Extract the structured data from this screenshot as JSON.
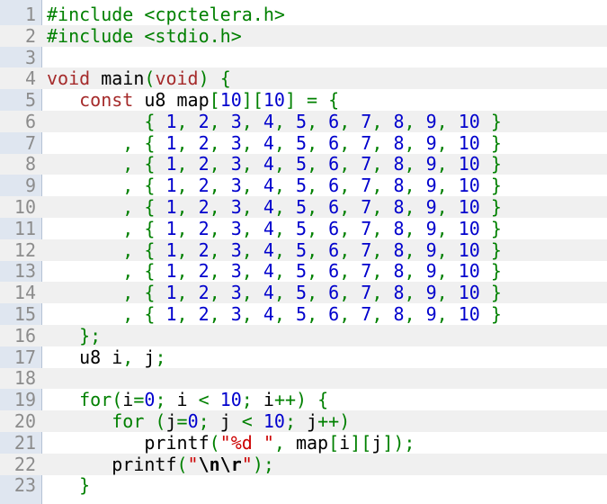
{
  "editor": {
    "lines": [
      [
        {
          "t": "#include <cpctelera.h>",
          "c": "pp"
        }
      ],
      [
        {
          "t": "#include <stdio.h>",
          "c": "pp"
        }
      ],
      [],
      [
        {
          "t": "void",
          "c": "kw"
        },
        {
          "t": " main",
          "c": "id"
        },
        {
          "t": "(",
          "c": "gr"
        },
        {
          "t": "void",
          "c": "kw"
        },
        {
          "t": ")",
          "c": "gr"
        },
        {
          "t": " {",
          "c": "gr"
        }
      ],
      [
        {
          "t": "   ",
          "c": "id"
        },
        {
          "t": "const",
          "c": "kw"
        },
        {
          "t": " u8 map",
          "c": "id"
        },
        {
          "t": "[",
          "c": "gr"
        },
        {
          "t": "10",
          "c": "num"
        },
        {
          "t": "][",
          "c": "gr"
        },
        {
          "t": "10",
          "c": "num"
        },
        {
          "t": "]",
          "c": "gr"
        },
        {
          "t": " = {",
          "c": "gr"
        }
      ],
      [
        {
          "t": "         { ",
          "c": "gr"
        },
        {
          "t": "1",
          "c": "num"
        },
        {
          "t": ", ",
          "c": "gr"
        },
        {
          "t": "2",
          "c": "num"
        },
        {
          "t": ", ",
          "c": "gr"
        },
        {
          "t": "3",
          "c": "num"
        },
        {
          "t": ", ",
          "c": "gr"
        },
        {
          "t": "4",
          "c": "num"
        },
        {
          "t": ", ",
          "c": "gr"
        },
        {
          "t": "5",
          "c": "num"
        },
        {
          "t": ", ",
          "c": "gr"
        },
        {
          "t": "6",
          "c": "num"
        },
        {
          "t": ", ",
          "c": "gr"
        },
        {
          "t": "7",
          "c": "num"
        },
        {
          "t": ", ",
          "c": "gr"
        },
        {
          "t": "8",
          "c": "num"
        },
        {
          "t": ", ",
          "c": "gr"
        },
        {
          "t": "9",
          "c": "num"
        },
        {
          "t": ", ",
          "c": "gr"
        },
        {
          "t": "10",
          "c": "num"
        },
        {
          "t": " }",
          "c": "gr"
        }
      ],
      [
        {
          "t": "       , { ",
          "c": "gr"
        },
        {
          "t": "1",
          "c": "num"
        },
        {
          "t": ", ",
          "c": "gr"
        },
        {
          "t": "2",
          "c": "num"
        },
        {
          "t": ", ",
          "c": "gr"
        },
        {
          "t": "3",
          "c": "num"
        },
        {
          "t": ", ",
          "c": "gr"
        },
        {
          "t": "4",
          "c": "num"
        },
        {
          "t": ", ",
          "c": "gr"
        },
        {
          "t": "5",
          "c": "num"
        },
        {
          "t": ", ",
          "c": "gr"
        },
        {
          "t": "6",
          "c": "num"
        },
        {
          "t": ", ",
          "c": "gr"
        },
        {
          "t": "7",
          "c": "num"
        },
        {
          "t": ", ",
          "c": "gr"
        },
        {
          "t": "8",
          "c": "num"
        },
        {
          "t": ", ",
          "c": "gr"
        },
        {
          "t": "9",
          "c": "num"
        },
        {
          "t": ", ",
          "c": "gr"
        },
        {
          "t": "10",
          "c": "num"
        },
        {
          "t": " }",
          "c": "gr"
        }
      ],
      [
        {
          "t": "       , { ",
          "c": "gr"
        },
        {
          "t": "1",
          "c": "num"
        },
        {
          "t": ", ",
          "c": "gr"
        },
        {
          "t": "2",
          "c": "num"
        },
        {
          "t": ", ",
          "c": "gr"
        },
        {
          "t": "3",
          "c": "num"
        },
        {
          "t": ", ",
          "c": "gr"
        },
        {
          "t": "4",
          "c": "num"
        },
        {
          "t": ", ",
          "c": "gr"
        },
        {
          "t": "5",
          "c": "num"
        },
        {
          "t": ", ",
          "c": "gr"
        },
        {
          "t": "6",
          "c": "num"
        },
        {
          "t": ", ",
          "c": "gr"
        },
        {
          "t": "7",
          "c": "num"
        },
        {
          "t": ", ",
          "c": "gr"
        },
        {
          "t": "8",
          "c": "num"
        },
        {
          "t": ", ",
          "c": "gr"
        },
        {
          "t": "9",
          "c": "num"
        },
        {
          "t": ", ",
          "c": "gr"
        },
        {
          "t": "10",
          "c": "num"
        },
        {
          "t": " }",
          "c": "gr"
        }
      ],
      [
        {
          "t": "       , { ",
          "c": "gr"
        },
        {
          "t": "1",
          "c": "num"
        },
        {
          "t": ", ",
          "c": "gr"
        },
        {
          "t": "2",
          "c": "num"
        },
        {
          "t": ", ",
          "c": "gr"
        },
        {
          "t": "3",
          "c": "num"
        },
        {
          "t": ", ",
          "c": "gr"
        },
        {
          "t": "4",
          "c": "num"
        },
        {
          "t": ", ",
          "c": "gr"
        },
        {
          "t": "5",
          "c": "num"
        },
        {
          "t": ", ",
          "c": "gr"
        },
        {
          "t": "6",
          "c": "num"
        },
        {
          "t": ", ",
          "c": "gr"
        },
        {
          "t": "7",
          "c": "num"
        },
        {
          "t": ", ",
          "c": "gr"
        },
        {
          "t": "8",
          "c": "num"
        },
        {
          "t": ", ",
          "c": "gr"
        },
        {
          "t": "9",
          "c": "num"
        },
        {
          "t": ", ",
          "c": "gr"
        },
        {
          "t": "10",
          "c": "num"
        },
        {
          "t": " }",
          "c": "gr"
        }
      ],
      [
        {
          "t": "       , { ",
          "c": "gr"
        },
        {
          "t": "1",
          "c": "num"
        },
        {
          "t": ", ",
          "c": "gr"
        },
        {
          "t": "2",
          "c": "num"
        },
        {
          "t": ", ",
          "c": "gr"
        },
        {
          "t": "3",
          "c": "num"
        },
        {
          "t": ", ",
          "c": "gr"
        },
        {
          "t": "4",
          "c": "num"
        },
        {
          "t": ", ",
          "c": "gr"
        },
        {
          "t": "5",
          "c": "num"
        },
        {
          "t": ", ",
          "c": "gr"
        },
        {
          "t": "6",
          "c": "num"
        },
        {
          "t": ", ",
          "c": "gr"
        },
        {
          "t": "7",
          "c": "num"
        },
        {
          "t": ", ",
          "c": "gr"
        },
        {
          "t": "8",
          "c": "num"
        },
        {
          "t": ", ",
          "c": "gr"
        },
        {
          "t": "9",
          "c": "num"
        },
        {
          "t": ", ",
          "c": "gr"
        },
        {
          "t": "10",
          "c": "num"
        },
        {
          "t": " }",
          "c": "gr"
        }
      ],
      [
        {
          "t": "       , { ",
          "c": "gr"
        },
        {
          "t": "1",
          "c": "num"
        },
        {
          "t": ", ",
          "c": "gr"
        },
        {
          "t": "2",
          "c": "num"
        },
        {
          "t": ", ",
          "c": "gr"
        },
        {
          "t": "3",
          "c": "num"
        },
        {
          "t": ", ",
          "c": "gr"
        },
        {
          "t": "4",
          "c": "num"
        },
        {
          "t": ", ",
          "c": "gr"
        },
        {
          "t": "5",
          "c": "num"
        },
        {
          "t": ", ",
          "c": "gr"
        },
        {
          "t": "6",
          "c": "num"
        },
        {
          "t": ", ",
          "c": "gr"
        },
        {
          "t": "7",
          "c": "num"
        },
        {
          "t": ", ",
          "c": "gr"
        },
        {
          "t": "8",
          "c": "num"
        },
        {
          "t": ", ",
          "c": "gr"
        },
        {
          "t": "9",
          "c": "num"
        },
        {
          "t": ", ",
          "c": "gr"
        },
        {
          "t": "10",
          "c": "num"
        },
        {
          "t": " }",
          "c": "gr"
        }
      ],
      [
        {
          "t": "       , { ",
          "c": "gr"
        },
        {
          "t": "1",
          "c": "num"
        },
        {
          "t": ", ",
          "c": "gr"
        },
        {
          "t": "2",
          "c": "num"
        },
        {
          "t": ", ",
          "c": "gr"
        },
        {
          "t": "3",
          "c": "num"
        },
        {
          "t": ", ",
          "c": "gr"
        },
        {
          "t": "4",
          "c": "num"
        },
        {
          "t": ", ",
          "c": "gr"
        },
        {
          "t": "5",
          "c": "num"
        },
        {
          "t": ", ",
          "c": "gr"
        },
        {
          "t": "6",
          "c": "num"
        },
        {
          "t": ", ",
          "c": "gr"
        },
        {
          "t": "7",
          "c": "num"
        },
        {
          "t": ", ",
          "c": "gr"
        },
        {
          "t": "8",
          "c": "num"
        },
        {
          "t": ", ",
          "c": "gr"
        },
        {
          "t": "9",
          "c": "num"
        },
        {
          "t": ", ",
          "c": "gr"
        },
        {
          "t": "10",
          "c": "num"
        },
        {
          "t": " }",
          "c": "gr"
        }
      ],
      [
        {
          "t": "       , { ",
          "c": "gr"
        },
        {
          "t": "1",
          "c": "num"
        },
        {
          "t": ", ",
          "c": "gr"
        },
        {
          "t": "2",
          "c": "num"
        },
        {
          "t": ", ",
          "c": "gr"
        },
        {
          "t": "3",
          "c": "num"
        },
        {
          "t": ", ",
          "c": "gr"
        },
        {
          "t": "4",
          "c": "num"
        },
        {
          "t": ", ",
          "c": "gr"
        },
        {
          "t": "5",
          "c": "num"
        },
        {
          "t": ", ",
          "c": "gr"
        },
        {
          "t": "6",
          "c": "num"
        },
        {
          "t": ", ",
          "c": "gr"
        },
        {
          "t": "7",
          "c": "num"
        },
        {
          "t": ", ",
          "c": "gr"
        },
        {
          "t": "8",
          "c": "num"
        },
        {
          "t": ", ",
          "c": "gr"
        },
        {
          "t": "9",
          "c": "num"
        },
        {
          "t": ", ",
          "c": "gr"
        },
        {
          "t": "10",
          "c": "num"
        },
        {
          "t": " }",
          "c": "gr"
        }
      ],
      [
        {
          "t": "       , { ",
          "c": "gr"
        },
        {
          "t": "1",
          "c": "num"
        },
        {
          "t": ", ",
          "c": "gr"
        },
        {
          "t": "2",
          "c": "num"
        },
        {
          "t": ", ",
          "c": "gr"
        },
        {
          "t": "3",
          "c": "num"
        },
        {
          "t": ", ",
          "c": "gr"
        },
        {
          "t": "4",
          "c": "num"
        },
        {
          "t": ", ",
          "c": "gr"
        },
        {
          "t": "5",
          "c": "num"
        },
        {
          "t": ", ",
          "c": "gr"
        },
        {
          "t": "6",
          "c": "num"
        },
        {
          "t": ", ",
          "c": "gr"
        },
        {
          "t": "7",
          "c": "num"
        },
        {
          "t": ", ",
          "c": "gr"
        },
        {
          "t": "8",
          "c": "num"
        },
        {
          "t": ", ",
          "c": "gr"
        },
        {
          "t": "9",
          "c": "num"
        },
        {
          "t": ", ",
          "c": "gr"
        },
        {
          "t": "10",
          "c": "num"
        },
        {
          "t": " }",
          "c": "gr"
        }
      ],
      [
        {
          "t": "       , { ",
          "c": "gr"
        },
        {
          "t": "1",
          "c": "num"
        },
        {
          "t": ", ",
          "c": "gr"
        },
        {
          "t": "2",
          "c": "num"
        },
        {
          "t": ", ",
          "c": "gr"
        },
        {
          "t": "3",
          "c": "num"
        },
        {
          "t": ", ",
          "c": "gr"
        },
        {
          "t": "4",
          "c": "num"
        },
        {
          "t": ", ",
          "c": "gr"
        },
        {
          "t": "5",
          "c": "num"
        },
        {
          "t": ", ",
          "c": "gr"
        },
        {
          "t": "6",
          "c": "num"
        },
        {
          "t": ", ",
          "c": "gr"
        },
        {
          "t": "7",
          "c": "num"
        },
        {
          "t": ", ",
          "c": "gr"
        },
        {
          "t": "8",
          "c": "num"
        },
        {
          "t": ", ",
          "c": "gr"
        },
        {
          "t": "9",
          "c": "num"
        },
        {
          "t": ", ",
          "c": "gr"
        },
        {
          "t": "10",
          "c": "num"
        },
        {
          "t": " }",
          "c": "gr"
        }
      ],
      [
        {
          "t": "   };",
          "c": "gr"
        }
      ],
      [
        {
          "t": "   u8 i",
          "c": "id"
        },
        {
          "t": ",",
          "c": "gr"
        },
        {
          "t": " j",
          "c": "id"
        },
        {
          "t": ";",
          "c": "gr"
        }
      ],
      [],
      [
        {
          "t": "   ",
          "c": "id"
        },
        {
          "t": "for",
          "c": "bl"
        },
        {
          "t": "(",
          "c": "gr"
        },
        {
          "t": "i",
          "c": "id"
        },
        {
          "t": "=",
          "c": "gr"
        },
        {
          "t": "0",
          "c": "num"
        },
        {
          "t": ";",
          "c": "gr"
        },
        {
          "t": " i ",
          "c": "id"
        },
        {
          "t": "<",
          "c": "gr"
        },
        {
          "t": " ",
          "c": "id"
        },
        {
          "t": "10",
          "c": "num"
        },
        {
          "t": ";",
          "c": "gr"
        },
        {
          "t": " i",
          "c": "id"
        },
        {
          "t": "++)",
          "c": "gr"
        },
        {
          "t": " {",
          "c": "gr"
        }
      ],
      [
        {
          "t": "      ",
          "c": "id"
        },
        {
          "t": "for",
          "c": "bl"
        },
        {
          "t": " (",
          "c": "gr"
        },
        {
          "t": "j",
          "c": "id"
        },
        {
          "t": "=",
          "c": "gr"
        },
        {
          "t": "0",
          "c": "num"
        },
        {
          "t": ";",
          "c": "gr"
        },
        {
          "t": " j ",
          "c": "id"
        },
        {
          "t": "<",
          "c": "gr"
        },
        {
          "t": " ",
          "c": "id"
        },
        {
          "t": "10",
          "c": "num"
        },
        {
          "t": ";",
          "c": "gr"
        },
        {
          "t": " j",
          "c": "id"
        },
        {
          "t": "++)",
          "c": "gr"
        }
      ],
      [
        {
          "t": "         printf",
          "c": "id"
        },
        {
          "t": "(",
          "c": "gr"
        },
        {
          "t": "\"%d \"",
          "c": "str"
        },
        {
          "t": ",",
          "c": "gr"
        },
        {
          "t": " map",
          "c": "id"
        },
        {
          "t": "[",
          "c": "gr"
        },
        {
          "t": "i",
          "c": "id"
        },
        {
          "t": "][",
          "c": "gr"
        },
        {
          "t": "j",
          "c": "id"
        },
        {
          "t": "]);",
          "c": "gr"
        }
      ],
      [
        {
          "t": "      printf",
          "c": "id"
        },
        {
          "t": "(",
          "c": "gr"
        },
        {
          "t": "\"",
          "c": "str"
        },
        {
          "t": "\\n\\r",
          "c": "esc"
        },
        {
          "t": "\"",
          "c": "str"
        },
        {
          "t": ");",
          "c": "gr"
        }
      ],
      [
        {
          "t": "   }",
          "c": "gr"
        }
      ]
    ]
  }
}
